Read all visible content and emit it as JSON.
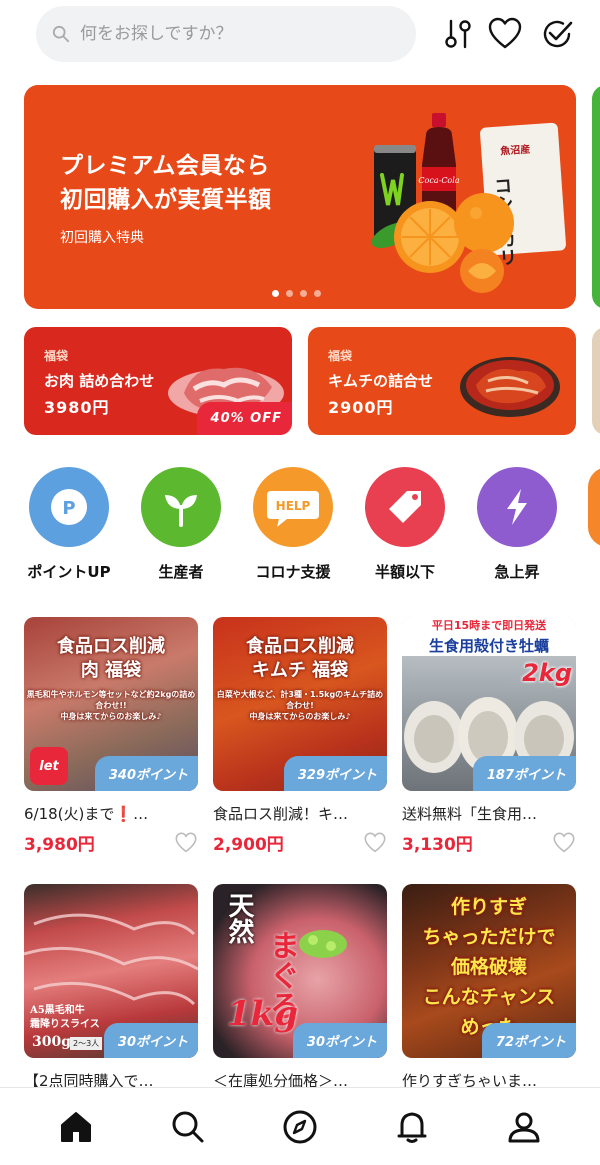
{
  "search": {
    "placeholder": "何をお探しですか？"
  },
  "header_icons": [
    "filter-icon",
    "heart-icon",
    "check-circle-icon"
  ],
  "hero": {
    "title": "プレミアム会員なら\n初回購入が実質半額",
    "subtitle": "初回購入特典",
    "product_labels": {
      "rice_vertical": "コシヒカリ",
      "rice_origin": "魚沼産",
      "cola": "Coca-Cola"
    },
    "dots": 4,
    "active_dot": 0,
    "color": "#e84918"
  },
  "promos": [
    {
      "tag": "福袋",
      "name": "お肉 詰め合わせ",
      "price": "3980円",
      "badge": "40% OFF",
      "color": "#d9281d"
    },
    {
      "tag": "福袋",
      "name": "キムチの詰合せ",
      "price": "2900円",
      "badge": "",
      "color": "#e84918"
    }
  ],
  "categories": [
    {
      "label": "ポイントUP",
      "icon": "points-icon",
      "color": "#5da0e0",
      "glyph": "P"
    },
    {
      "label": "生産者",
      "icon": "sprout-icon",
      "color": "#5cb82e",
      "glyph": ""
    },
    {
      "label": "コロナ支援",
      "icon": "help-bubble-icon",
      "color": "#f59a2a",
      "glyph": "HELP"
    },
    {
      "label": "半額以下",
      "icon": "price-tag-icon",
      "color": "#e84050",
      "glyph": ""
    },
    {
      "label": "急上昇",
      "icon": "lightning-icon",
      "color": "#8f5ccf",
      "glyph": ""
    }
  ],
  "products": [
    {
      "title": "6/18(火)まで❗…",
      "price": "3,980円",
      "points": "340ポイント",
      "poster": "食品ロス削減\n肉 福袋",
      "poster_note": "黒毛和牛やホルモン等セットなど約2kgの詰め合わせ!!\n中身は来てからのお楽しみ♪",
      "logo": "let"
    },
    {
      "title": "食品ロス削減！キ…",
      "price": "2,900円",
      "points": "329ポイント",
      "poster": "食品ロス削減\nキムチ 福袋",
      "poster_note": "白菜や大根など、計3種・1.5kgのキムチ詰め合わせ!\n中身は来てからのお楽しみ♪"
    },
    {
      "title": "送料無料「生食用…",
      "price": "3,130円",
      "points": "187ポイント",
      "poster": "平日15時まで即日発送",
      "poster_sub": "生食用殻付き牡蠣",
      "poster_weight": "2kg"
    },
    {
      "title": "【2点同時購入で…",
      "price": "",
      "points": "30ポイント",
      "poster": "A5黒毛和牛\n霜降りスライス",
      "poster_weight": "300g",
      "poster_note": "2～3人"
    },
    {
      "title": "＜在庫処分価格＞…",
      "price": "",
      "points": "30ポイント",
      "poster": "天然",
      "poster_sub": "まぐろ",
      "poster_weight": "1kg"
    },
    {
      "title": "作りすぎちゃいま…",
      "price": "",
      "points": "72ポイント",
      "poster": "作りすぎ\nちゃっただけで\n価格破壊\nこんなチャンス\nめった"
    }
  ],
  "bottom_nav": [
    {
      "name": "home",
      "icon": "home-icon",
      "active": true
    },
    {
      "name": "search",
      "icon": "search-icon",
      "active": false
    },
    {
      "name": "discover",
      "icon": "compass-icon",
      "active": false
    },
    {
      "name": "notifications",
      "icon": "bell-icon",
      "active": false
    },
    {
      "name": "profile",
      "icon": "user-icon",
      "active": false
    }
  ],
  "colors": {
    "price_red": "#e8283a",
    "points_blue": "#6aa7db"
  }
}
